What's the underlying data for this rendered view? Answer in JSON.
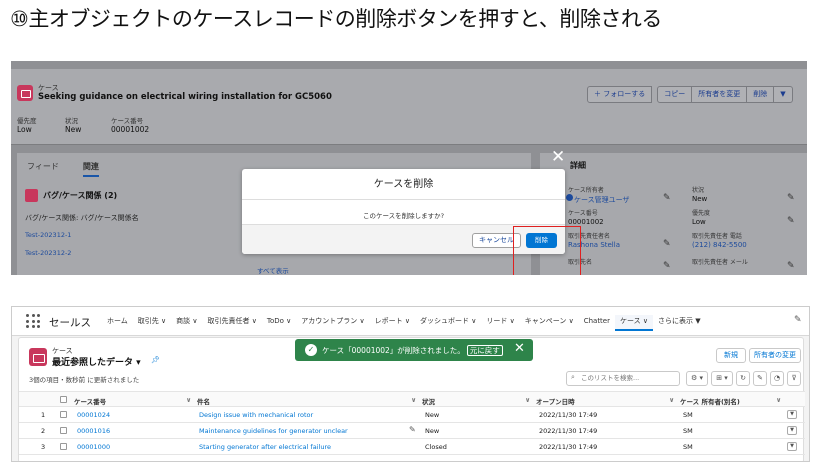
{
  "title": "⑩主オブジェクトのケースレコードの削除ボタンを押すと、削除される",
  "top": {
    "object_label": "ケース",
    "subject": "Seeking guidance on electrical wiring installation for GC5060",
    "buttons": [
      "＋ フォローする",
      "コピー",
      "所有者を変更",
      "削除",
      "▼"
    ],
    "fields": [
      {
        "label": "優先度",
        "value": "Low"
      },
      {
        "label": "状況",
        "value": "New"
      },
      {
        "label": "ケース番号",
        "value": "00001002"
      }
    ],
    "tabs": [
      "フィード",
      "関連"
    ],
    "related_title": "バグ/ケース関係 (2)",
    "related_header": "バグ/ケース関係: バグ/ケース関係名",
    "related_items": [
      "Test-202312-1",
      "Test-202312-2"
    ],
    "show_all": "すべて表示",
    "detail_tab": "詳細",
    "detail_fields": [
      {
        "label": "ケース所有者",
        "value": "ケース管理ユーザ"
      },
      {
        "label": "ケース番号",
        "value": "00001002"
      },
      {
        "label": "取引先責任者名",
        "value": "Rashona Stella"
      },
      {
        "label": "取引先名",
        "value": ""
      },
      {
        "label": "状況",
        "value": "New"
      },
      {
        "label": "優先度",
        "value": "Low"
      },
      {
        "label": "取引先責任者 電話",
        "value": "(212) 842-5500"
      },
      {
        "label": "取引先責任者 メール",
        "value": ""
      }
    ],
    "modal": {
      "title": "ケースを削除",
      "body": "このケースを削除しますか?",
      "cancel": "キャンセル",
      "delete": "削除"
    }
  },
  "bottom": {
    "app_name": "セールス",
    "nav": [
      "ホーム",
      "取引先 ∨",
      "商談 ∨",
      "取引先責任者 ∨",
      "ToDo ∨",
      "アカウントプラン ∨",
      "レポート ∨",
      "ダッシュボード ∨",
      "リード ∨",
      "キャンペーン ∨",
      "Chatter",
      "ケース ∨",
      "さらに表示 ▼"
    ],
    "object_name": "ケース",
    "list_name": "最近参照したデータ ▾",
    "count_text": "3個の項目・数秒前 に更新されました",
    "new_button": "新規",
    "owner_button": "所有者の変更",
    "search_placeholder": "このリストを検索...",
    "tools": [
      "⚙ ▾",
      "⊞ ▾",
      "↻",
      "✎",
      "◔",
      "⊽"
    ],
    "toast": {
      "text": "ケース「00001002」が削除されました。",
      "undo": "元に戻す",
      "close": "✕"
    },
    "columns": [
      "ケース番号",
      "件名",
      "状況",
      "オープン日時",
      "ケース 所有者(別名)"
    ],
    "rows": [
      {
        "num": "1",
        "case": "00001024",
        "subject": "Design issue with mechanical rotor",
        "status": "New",
        "opened": "2022/11/30 17:49",
        "owner": "SM"
      },
      {
        "num": "2",
        "case": "00001016",
        "subject": "Maintenance guidelines for generator unclear",
        "status": "New",
        "opened": "2022/11/30 17:49",
        "owner": "SM"
      },
      {
        "num": "3",
        "case": "00001000",
        "subject": "Starting generator after electrical failure",
        "status": "Closed",
        "opened": "2022/11/30 17:49",
        "owner": "SM"
      }
    ]
  }
}
